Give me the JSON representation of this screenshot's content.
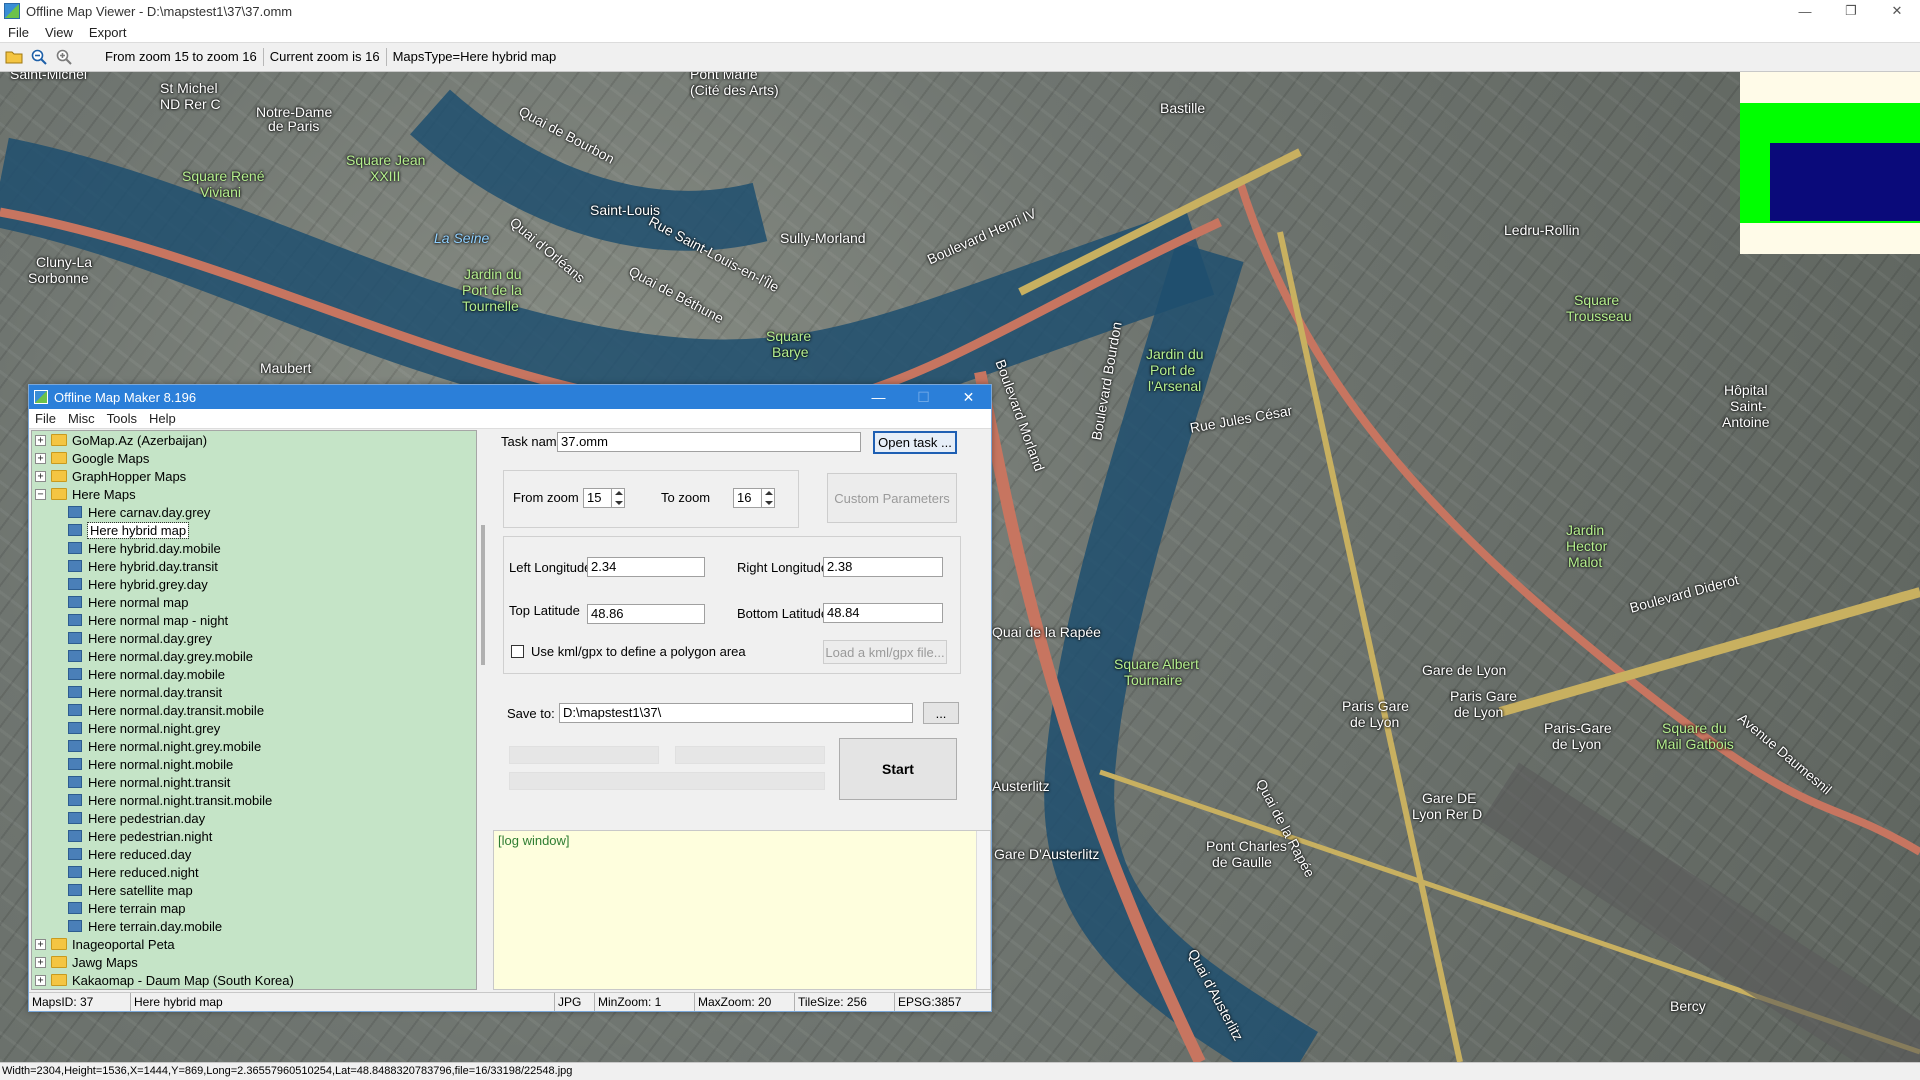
{
  "viewer": {
    "title": "Offline Map Viewer - D:\\mapstest1\\37\\37.omm",
    "window_controls": [
      "—",
      "❐",
      "✕"
    ],
    "menu": [
      "File",
      "View",
      "Export"
    ],
    "toolbar_status": {
      "zoom_range": "From zoom 15 to zoom 16",
      "current_zoom": "Current zoom is 16",
      "maps_type": "MapsType=Here hybrid map"
    },
    "status_bar": "Width=2304,Height=1536,X=1444,Y=869,Long=2.36557960510254,Lat=48.8488320783796,file=16/33198/22548.jpg"
  },
  "map_labels": [
    {
      "text": "Saint-Michel",
      "style": ""
    },
    {
      "text": "St Michel",
      "style": ""
    },
    {
      "text": "ND Rer C",
      "style": ""
    },
    {
      "text": "Pont Marie",
      "style": ""
    },
    {
      "text": "(Cité des Arts)",
      "style": ""
    },
    {
      "text": "Notre-Dame",
      "style": ""
    },
    {
      "text": "de Paris",
      "style": ""
    },
    {
      "text": "Square Jean",
      "style": "green"
    },
    {
      "text": "XXIII",
      "style": "green"
    },
    {
      "text": "Square René",
      "style": "green"
    },
    {
      "text": "Viviani",
      "style": "green"
    },
    {
      "text": "La Seine",
      "style": "blue"
    },
    {
      "text": "Quai de Bourbon",
      "style": ""
    },
    {
      "text": "Quai d'Orléans",
      "style": ""
    },
    {
      "text": "Saint-Louis",
      "style": ""
    },
    {
      "text": "Rue Saint-Louis-en-l'Île",
      "style": ""
    },
    {
      "text": "Quai de Béthune",
      "style": ""
    },
    {
      "text": "Sully-Morland",
      "style": ""
    },
    {
      "text": "Bastille",
      "style": ""
    },
    {
      "text": "Boulevard Henri IV",
      "style": ""
    },
    {
      "text": "Ledru-Rollin",
      "style": ""
    },
    {
      "text": "Cluny-La",
      "style": ""
    },
    {
      "text": "Sorbonne",
      "style": ""
    },
    {
      "text": "Jardin du",
      "style": "green"
    },
    {
      "text": "Port de la",
      "style": "green"
    },
    {
      "text": "Tournelle",
      "style": "green"
    },
    {
      "text": "Square",
      "style": "green"
    },
    {
      "text": "Barye",
      "style": "green"
    },
    {
      "text": "Maubert",
      "style": ""
    },
    {
      "text": "Boulevard Bourdon",
      "style": ""
    },
    {
      "text": "Jardin du",
      "style": "green"
    },
    {
      "text": "Port de",
      "style": "green"
    },
    {
      "text": "l'Arsenal",
      "style": "green"
    },
    {
      "text": "Rue Jules César",
      "style": ""
    },
    {
      "text": "Square",
      "style": "green"
    },
    {
      "text": "Trousseau",
      "style": "green"
    },
    {
      "text": "Hôpital",
      "style": ""
    },
    {
      "text": "Saint-",
      "style": ""
    },
    {
      "text": "Antoine",
      "style": ""
    },
    {
      "text": "Jardin",
      "style": "green"
    },
    {
      "text": "Hector",
      "style": "green"
    },
    {
      "text": "Malot",
      "style": "green"
    },
    {
      "text": "Boulevard Diderot",
      "style": ""
    },
    {
      "text": "Quai de la Rapée",
      "style": ""
    },
    {
      "text": "Square Albert",
      "style": "green"
    },
    {
      "text": "Tournaire",
      "style": "green"
    },
    {
      "text": "Gare de Lyon",
      "style": ""
    },
    {
      "text": "Paris Gare",
      "style": ""
    },
    {
      "text": "de Lyon",
      "style": ""
    },
    {
      "text": "Paris Gare",
      "style": ""
    },
    {
      "text": "de Lyon",
      "style": ""
    },
    {
      "text": "Paris-Gare",
      "style": ""
    },
    {
      "text": "de Lyon",
      "style": ""
    },
    {
      "text": "Square du",
      "style": "green"
    },
    {
      "text": "Mail Gatbois",
      "style": "green"
    },
    {
      "text": "Avenue Daumesnil",
      "style": ""
    },
    {
      "text": "Gare DE",
      "style": ""
    },
    {
      "text": "Lyon Rer D",
      "style": ""
    },
    {
      "text": "Austerlitz",
      "style": ""
    },
    {
      "text": "Gare D'Austerlitz",
      "style": ""
    },
    {
      "text": "Pont Charles",
      "style": ""
    },
    {
      "text": "de Gaulle",
      "style": ""
    },
    {
      "text": "Quai de la Rapée",
      "style": ""
    },
    {
      "text": "Quai d'Austerlitz",
      "style": ""
    },
    {
      "text": "Bercy",
      "style": ""
    },
    {
      "text": "Boulevard Morland",
      "style": ""
    }
  ],
  "maker": {
    "title": "Offline Map Maker 8.196",
    "window_controls": [
      "—",
      "☐",
      "✕"
    ],
    "menu": [
      "File",
      "Misc",
      "Tools",
      "Help"
    ],
    "tree": [
      {
        "type": "folder",
        "expander": "+",
        "label": "GoMap.Az (Azerbaijan)"
      },
      {
        "type": "folder",
        "expander": "+",
        "label": "Google Maps"
      },
      {
        "type": "folder",
        "expander": "+",
        "label": "GraphHopper Maps"
      },
      {
        "type": "folder",
        "expander": "−",
        "label": "Here Maps"
      },
      {
        "type": "leaf",
        "label": "Here carnav.day.grey"
      },
      {
        "type": "leaf",
        "label": "Here hybrid map",
        "selected": true
      },
      {
        "type": "leaf",
        "label": "Here hybrid.day.mobile"
      },
      {
        "type": "leaf",
        "label": "Here hybrid.day.transit"
      },
      {
        "type": "leaf",
        "label": "Here hybrid.grey.day"
      },
      {
        "type": "leaf",
        "label": "Here normal map"
      },
      {
        "type": "leaf",
        "label": "Here normal map - night"
      },
      {
        "type": "leaf",
        "label": "Here normal.day.grey"
      },
      {
        "type": "leaf",
        "label": "Here normal.day.grey.mobile"
      },
      {
        "type": "leaf",
        "label": "Here normal.day.mobile"
      },
      {
        "type": "leaf",
        "label": "Here normal.day.transit"
      },
      {
        "type": "leaf",
        "label": "Here normal.day.transit.mobile"
      },
      {
        "type": "leaf",
        "label": "Here normal.night.grey"
      },
      {
        "type": "leaf",
        "label": "Here normal.night.grey.mobile"
      },
      {
        "type": "leaf",
        "label": "Here normal.night.mobile"
      },
      {
        "type": "leaf",
        "label": "Here normal.night.transit"
      },
      {
        "type": "leaf",
        "label": "Here normal.night.transit.mobile"
      },
      {
        "type": "leaf",
        "label": "Here pedestrian.day"
      },
      {
        "type": "leaf",
        "label": "Here pedestrian.night"
      },
      {
        "type": "leaf",
        "label": "Here reduced.day"
      },
      {
        "type": "leaf",
        "label": "Here reduced.night"
      },
      {
        "type": "leaf",
        "label": "Here satellite map"
      },
      {
        "type": "leaf",
        "label": "Here terrain map"
      },
      {
        "type": "leaf",
        "label": "Here terrain.day.mobile"
      },
      {
        "type": "folder",
        "expander": "+",
        "label": "Inageoportal Peta"
      },
      {
        "type": "folder",
        "expander": "+",
        "label": "Jawg Maps"
      },
      {
        "type": "folder",
        "expander": "+",
        "label": "Kakaomap - Daum Map (South Korea)"
      }
    ],
    "form": {
      "task_name_label": "Task name",
      "task_name_value": "37.omm",
      "open_task_label": "Open task ...",
      "from_zoom_label": "From zoom",
      "from_zoom_value": "15",
      "to_zoom_label": "To zoom",
      "to_zoom_value": "16",
      "custom_params_label": "Custom Parameters",
      "left_lon_label": "Left Longitude",
      "left_lon_value": "2.34",
      "right_lon_label": "Right Longitude",
      "right_lon_value": "2.38",
      "top_lat_label": "Top Latitude",
      "top_lat_value": "48.86",
      "bottom_lat_label": "Bottom Latitude",
      "bottom_lat_value": "48.84",
      "kml_checkbox_label": "Use kml/gpx to define a polygon area",
      "kml_checked": false,
      "load_kml_label": "Load a kml/gpx file...",
      "save_to_label": "Save to:",
      "save_to_value": "D:\\mapstest1\\37\\",
      "browse_label": "...",
      "start_label": "Start"
    },
    "log_text": "[log window]",
    "status": {
      "maps_id": "MapsID: 37",
      "map_name": "Here hybrid map",
      "format": "JPG",
      "min_zoom": "MinZoom: 1",
      "max_zoom": "MaxZoom: 20",
      "tile_size": "TileSize: 256",
      "epsg": "EPSG:3857"
    }
  }
}
